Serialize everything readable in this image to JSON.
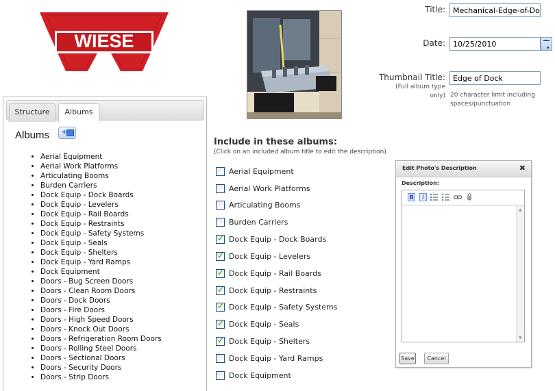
{
  "logo": {
    "text": "WIESE",
    "brand_color": "#d11f26"
  },
  "form": {
    "title_label": "Title:",
    "title_value": "Mechanical-Edge-of-Dock",
    "date_label": "Date:",
    "date_value": "10/25/2010",
    "thumb_label": "Thumbnail Title:",
    "thumb_note_1": "(Full album type",
    "thumb_note_2": "only)",
    "thumb_value": "Edge of Dock",
    "char_limit_1": "20 character limit including",
    "char_limit_2": "spaces/punctuation"
  },
  "tabs": [
    {
      "label": "Structure"
    },
    {
      "label": "Albums"
    }
  ],
  "albums_panel": {
    "heading": "Albums",
    "items": [
      "Aerial Equipment",
      "Aerial Work Platforms",
      "Articulating Booms",
      "Burden Carriers",
      "Dock Equip - Dock Boards",
      "Dock Equip - Levelers",
      "Dock Equip - Rail Boards",
      "Dock Equip - Restraints",
      "Dock Equip - Safety Systems",
      "Dock Equip - Seals",
      "Dock Equip - Shelters",
      "Dock Equip - Yard Ramps",
      "Dock Equipment",
      "Doors - Bug Screen Doors",
      "Doors - Clean Room Doors",
      "Doors - Dock Doors",
      "Doors - Fire Doors",
      "Doors - High Speed Doors",
      "Doors - Knock Out Doors",
      "Doors - Refrigeration Room Doors",
      "Doors - Rolling Steel Doors",
      "Doors - Sectional Doors",
      "Doors - Security Doors",
      "Doors - Strip Doors"
    ]
  },
  "include": {
    "title": "Include in these albums:",
    "subtitle": "(Click on an included album title to edit the description)",
    "items": [
      {
        "label": "Aerial Equipment",
        "checked": false
      },
      {
        "label": "Aerial Work Platforms",
        "checked": false
      },
      {
        "label": "Articulating Booms",
        "checked": false
      },
      {
        "label": "Burden Carriers",
        "checked": false
      },
      {
        "label": "Dock Equip - Dock Boards",
        "checked": true
      },
      {
        "label": "Dock Equip - Levelers",
        "checked": true
      },
      {
        "label": "Dock Equip - Rail Boards",
        "checked": true
      },
      {
        "label": "Dock Equip - Restraints",
        "checked": true
      },
      {
        "label": "Dock Equip - Safety Systems",
        "checked": true
      },
      {
        "label": "Dock Equip - Seals",
        "checked": true
      },
      {
        "label": "Dock Equip - Shelters",
        "checked": true
      },
      {
        "label": "Dock Equip - Yard Ramps",
        "checked": false
      },
      {
        "label": "Dock Equipment",
        "checked": false
      }
    ]
  },
  "dialog": {
    "title": "Edit Photo's Description",
    "close": "✖",
    "desc_label": "Description:",
    "toolbar": {
      "bold": "B",
      "italic": "I"
    },
    "save_label": "Save",
    "cancel_label": "Cancel"
  }
}
